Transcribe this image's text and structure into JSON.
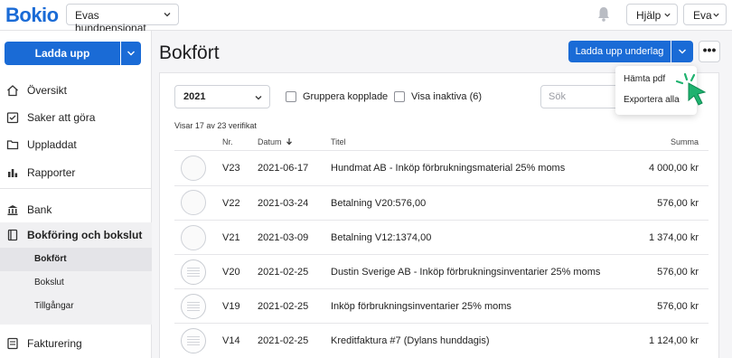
{
  "topbar": {
    "logo": "Bokio",
    "company": "Evas hundpensionat",
    "help": "Hjälp",
    "user": "Eva"
  },
  "sidebar": {
    "upload_label": "Ladda upp",
    "items": [
      {
        "label": "Översikt",
        "icon": "home-icon"
      },
      {
        "label": "Saker att göra",
        "icon": "checklist-icon"
      },
      {
        "label": "Uppladdat",
        "icon": "folder-icon"
      },
      {
        "label": "Rapporter",
        "icon": "bar-chart-icon"
      },
      {
        "label": "Bank",
        "icon": "bank-icon"
      },
      {
        "label": "Bokföring och bokslut",
        "icon": "book-icon"
      }
    ],
    "subitems": [
      {
        "label": "Bokfört"
      },
      {
        "label": "Bokslut"
      },
      {
        "label": "Tillgångar"
      }
    ],
    "bottom_item": {
      "label": "Fakturering",
      "icon": "invoice-icon"
    }
  },
  "main": {
    "title": "Bokfört",
    "upload_button": "Ladda upp underlag",
    "more_button": "•••",
    "year": "2021",
    "group_label": "Gruppera kopplade",
    "inactive_label": "Visa inaktiva (6)",
    "search_placeholder": "Sök",
    "count_text": "Visar 17 av 23 verifikat",
    "columns": {
      "nr": "Nr.",
      "date": "Datum",
      "title": "Titel",
      "sum": "Summa"
    },
    "rows": [
      {
        "nr": "V23",
        "date": "2021-06-17",
        "title": "Hundmat AB - Inköp förbrukningsmaterial 25% moms",
        "sum": "4 000,00 kr"
      },
      {
        "nr": "V22",
        "date": "2021-03-24",
        "title": "Betalning V20:576,00",
        "sum": "576,00 kr"
      },
      {
        "nr": "V21",
        "date": "2021-03-09",
        "title": "Betalning V12:1374,00",
        "sum": "1 374,00 kr"
      },
      {
        "nr": "V20",
        "date": "2021-02-25",
        "title": "Dustin Sverige AB - Inköp förbrukningsinventarier 25% moms",
        "sum": "576,00 kr"
      },
      {
        "nr": "V19",
        "date": "2021-02-25",
        "title": "Inköp förbrukningsinventarier 25% moms",
        "sum": "576,00 kr"
      },
      {
        "nr": "V14",
        "date": "2021-02-25",
        "title": "Kreditfaktura #7 (Dylans hunddagis)",
        "sum": "1 124,00 kr"
      }
    ]
  },
  "menu": {
    "items": [
      "Hämta pdf",
      "Exportera alla"
    ]
  },
  "colors": {
    "accent": "#1a6bd6",
    "cursor": "#1fb26f"
  }
}
